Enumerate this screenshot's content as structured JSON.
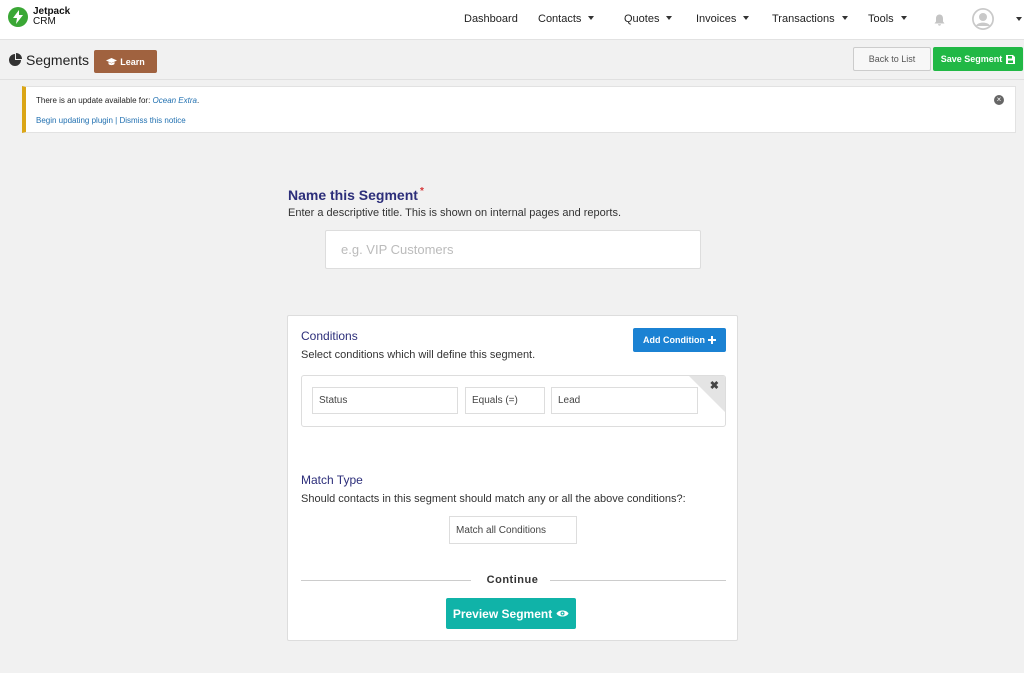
{
  "brand": {
    "line1": "Jetpack",
    "line2": "CRM"
  },
  "nav": {
    "dashboard": "Dashboard",
    "contacts": "Contacts",
    "quotes": "Quotes",
    "invoices": "Invoices",
    "transactions": "Transactions",
    "tools": "Tools"
  },
  "header": {
    "title": "Segments",
    "learn_label": "Learn",
    "back_label": "Back to List",
    "save_label": "Save Segment"
  },
  "notice": {
    "text": "There is an update available for: ",
    "plugin": "Ocean Extra",
    "period": ".",
    "update_link": "Begin updating plugin",
    "separator": " | ",
    "dismiss_link": "Dismiss this notice"
  },
  "name_section": {
    "title": "Name this Segment",
    "required_mark": "*",
    "description": "Enter a descriptive title. This is shown on internal pages and reports.",
    "placeholder": "e.g. VIP Customers"
  },
  "conditions": {
    "title": "Conditions",
    "description": "Select conditions which will define this segment.",
    "add_label": "Add Condition",
    "rows": [
      {
        "field": "Status",
        "operator": "Equals (=)",
        "value": "Lead"
      }
    ],
    "remove_glyph": "✖"
  },
  "match": {
    "title": "Match Type",
    "description": "Should contacts in this segment should match any or all the above conditions?:",
    "selected": "Match all Conditions"
  },
  "continue_label": "Continue",
  "preview_label": "Preview Segment",
  "colors": {
    "brand_green": "#3aa735",
    "save_green": "#21b845",
    "learn_brown": "#a0623f",
    "add_blue": "#1b82d3",
    "preview_teal": "#10b3a8",
    "heading_navy": "#2c2e7a",
    "notice_amber": "#dba617"
  }
}
